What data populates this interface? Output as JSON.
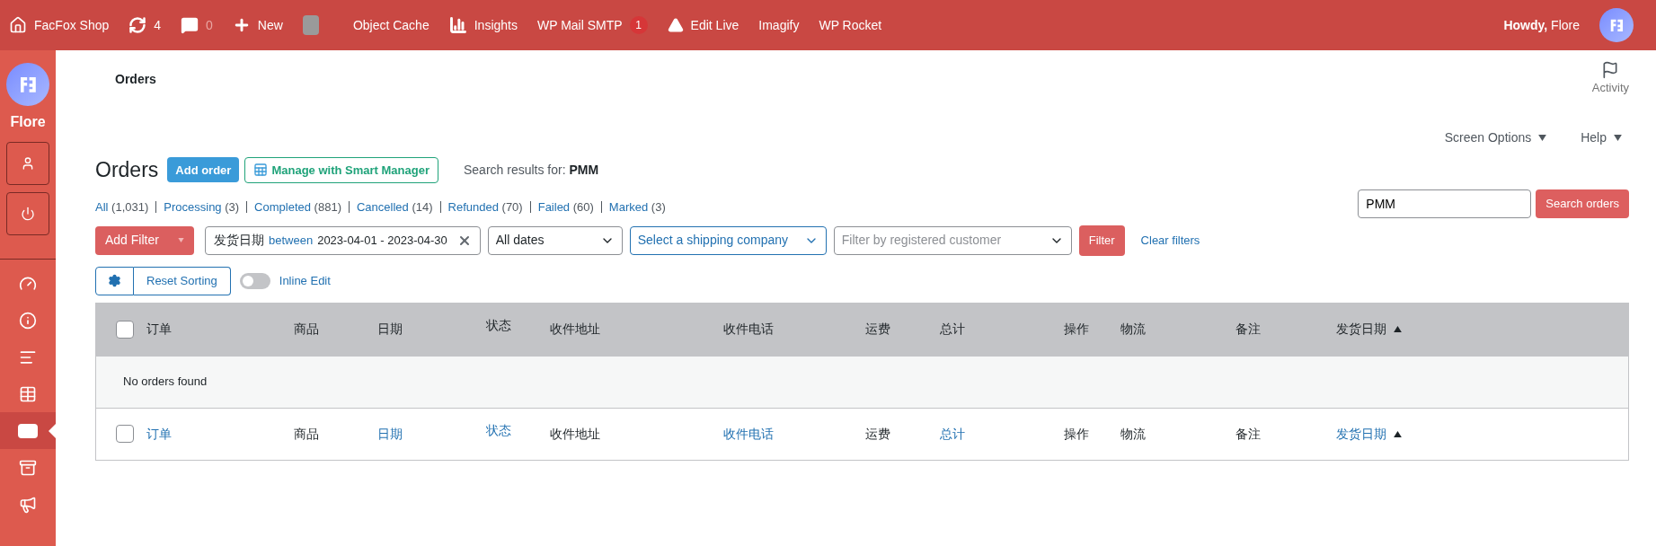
{
  "admin_bar": {
    "site": "FacFox Shop",
    "updates": "4",
    "comments": "0",
    "new": "New",
    "items": [
      "Object Cache",
      "Insights",
      "WP Mail SMTP",
      "Edit Live",
      "Imagify",
      "WP Rocket"
    ],
    "smtp_badge": "1",
    "greeting_bold": "Howdy,",
    "greeting_name": "Flore"
  },
  "sidebar": {
    "user": "Flore",
    "items": [
      {
        "kind": "dashboard",
        "selected": false
      },
      {
        "kind": "info",
        "selected": false
      },
      {
        "kind": "comment",
        "selected": false
      },
      {
        "kind": "table",
        "selected": false
      },
      {
        "kind": "woo",
        "selected": true
      },
      {
        "kind": "archive",
        "selected": false
      },
      {
        "kind": "megaphone",
        "selected": false
      }
    ]
  },
  "header": {
    "breadcrumb": "Orders",
    "activity": "Activity",
    "screen_options": "Screen Options",
    "help": "Help"
  },
  "page": {
    "title": "Orders",
    "add_order": "Add order",
    "smart_manager": "Manage with Smart Manager",
    "search_results_label": "Search results for:",
    "search_term": "PMM"
  },
  "status_links": [
    {
      "label": "All",
      "count": "(1,031)"
    },
    {
      "label": "Processing",
      "count": "(3)"
    },
    {
      "label": "Completed",
      "count": "(881)"
    },
    {
      "label": "Cancelled",
      "count": "(14)"
    },
    {
      "label": "Refunded",
      "count": "(70)"
    },
    {
      "label": "Failed",
      "count": "(60)"
    },
    {
      "label": "Marked",
      "count": "(3)"
    }
  ],
  "search": {
    "value": "PMM",
    "button": "Search orders"
  },
  "filters": {
    "add_filter": "Add Filter",
    "chip_field": "发货日期",
    "chip_op": "between",
    "chip_range": "2023-04-01 - 2023-04-30",
    "dates": "All dates",
    "shipping": "Select a shipping company",
    "customer_placeholder": "Filter by registered customer",
    "filter": "Filter",
    "clear": "Clear filters"
  },
  "tools": {
    "reset_sorting": "Reset Sorting",
    "inline_edit": "Inline Edit",
    "inline_edit_on": false
  },
  "table": {
    "header": [
      {
        "label": "订单",
        "sorted": false,
        "link": false
      },
      {
        "label": "商品",
        "sorted": false,
        "link": false
      },
      {
        "label": "日期",
        "sorted": false,
        "link": false
      },
      {
        "label": "状态",
        "sorted": false,
        "link": false
      },
      {
        "label": "收件地址",
        "sorted": false,
        "link": false
      },
      {
        "label": "收件电话",
        "sorted": false,
        "link": false
      },
      {
        "label": "运费",
        "sorted": false,
        "link": false
      },
      {
        "label": "总计",
        "sorted": false,
        "link": false
      },
      {
        "label": "操作",
        "sorted": false,
        "link": false
      },
      {
        "label": "物流",
        "sorted": false,
        "link": false
      },
      {
        "label": "备注",
        "sorted": false,
        "link": false
      },
      {
        "label": "发货日期",
        "sorted": true,
        "link": false
      }
    ],
    "footer": [
      {
        "label": "订单",
        "sorted": false,
        "link": true
      },
      {
        "label": "商品",
        "sorted": false,
        "link": false
      },
      {
        "label": "日期",
        "sorted": false,
        "link": true
      },
      {
        "label": "状态",
        "sorted": false,
        "link": true
      },
      {
        "label": "收件地址",
        "sorted": false,
        "link": false
      },
      {
        "label": "收件电话",
        "sorted": false,
        "link": true
      },
      {
        "label": "运费",
        "sorted": false,
        "link": false
      },
      {
        "label": "总计",
        "sorted": false,
        "link": true
      },
      {
        "label": "操作",
        "sorted": false,
        "link": false
      },
      {
        "label": "物流",
        "sorted": false,
        "link": false
      },
      {
        "label": "备注",
        "sorted": false,
        "link": false
      },
      {
        "label": "发货日期",
        "sorted": true,
        "link": true
      }
    ],
    "select_all_footer_checked": false,
    "select_all_checked": false,
    "empty": "No orders found"
  }
}
